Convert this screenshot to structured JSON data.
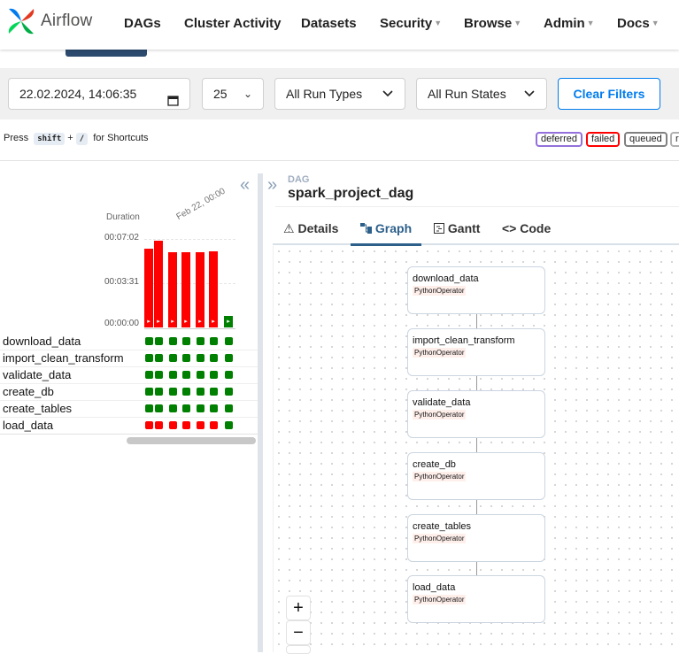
{
  "navbar": {
    "brand": "Airflow",
    "items": [
      {
        "label": "DAGs",
        "dropdown": false
      },
      {
        "label": "Cluster Activity",
        "dropdown": false
      },
      {
        "label": "Datasets",
        "dropdown": false
      },
      {
        "label": "Security",
        "dropdown": true
      },
      {
        "label": "Browse",
        "dropdown": true
      },
      {
        "label": "Admin",
        "dropdown": true
      },
      {
        "label": "Docs",
        "dropdown": true
      }
    ]
  },
  "filters": {
    "date_value": "22.02.2024, 14:06:35",
    "num_runs": "25",
    "run_types": "All Run Types",
    "run_states": "All Run States",
    "clear_label": "Clear Filters"
  },
  "shortcuts": {
    "press": "Press",
    "key1": "shift",
    "plus": "+",
    "key2": "/",
    "suffix": "for Shortcuts"
  },
  "state_legend": [
    {
      "label": "deferred",
      "color": "#9370db"
    },
    {
      "label": "failed",
      "color": "#ff0000"
    },
    {
      "label": "queued",
      "color": "#808080"
    },
    {
      "label": "r",
      "color": "#b0b0b0"
    }
  ],
  "grid": {
    "duration_label": "Duration",
    "date_label": "Feb 22, 00:00",
    "y_ticks": [
      "00:07:02",
      "00:03:31",
      "00:00:00"
    ],
    "runs": [
      {
        "duration_fraction": 0.91,
        "state": "failed"
      },
      {
        "duration_fraction": 1.0,
        "state": "failed"
      },
      {
        "duration_fraction": 0.87,
        "state": "failed"
      },
      {
        "duration_fraction": 0.87,
        "state": "failed"
      },
      {
        "duration_fraction": 0.87,
        "state": "failed"
      },
      {
        "duration_fraction": 0.88,
        "state": "failed"
      },
      {
        "duration_fraction": 0.0,
        "state": "success"
      }
    ],
    "tasks": [
      {
        "name": "download_data",
        "states": [
          "success",
          "success",
          "success",
          "success",
          "success",
          "success",
          "success"
        ]
      },
      {
        "name": "import_clean_transform",
        "states": [
          "success",
          "success",
          "success",
          "success",
          "success",
          "success",
          "success"
        ]
      },
      {
        "name": "validate_data",
        "states": [
          "success",
          "success",
          "success",
          "success",
          "success",
          "success",
          "success"
        ]
      },
      {
        "name": "create_db",
        "states": [
          "success",
          "success",
          "success",
          "success",
          "success",
          "success",
          "success"
        ]
      },
      {
        "name": "create_tables",
        "states": [
          "success",
          "success",
          "success",
          "success",
          "success",
          "success",
          "success"
        ]
      },
      {
        "name": "load_data",
        "states": [
          "failed",
          "failed",
          "failed",
          "failed",
          "failed",
          "failed",
          "success"
        ]
      }
    ],
    "colors": {
      "success": "#008000",
      "failed": "#ff0000"
    }
  },
  "dag": {
    "sub": "DAG",
    "name": "spark_project_dag"
  },
  "tabs": [
    {
      "label": "Details",
      "icon": "warning-icon"
    },
    {
      "label": "Graph",
      "icon": "graph-icon"
    },
    {
      "label": "Gantt",
      "icon": "gantt-icon"
    },
    {
      "label": "Code",
      "icon": "code-icon"
    }
  ],
  "graph_nodes": [
    {
      "name": "download_data",
      "operator": "PythonOperator"
    },
    {
      "name": "import_clean_transform",
      "operator": "PythonOperator"
    },
    {
      "name": "validate_data",
      "operator": "PythonOperator"
    },
    {
      "name": "create_db",
      "operator": "PythonOperator"
    },
    {
      "name": "create_tables",
      "operator": "PythonOperator"
    },
    {
      "name": "load_data",
      "operator": "PythonOperator"
    }
  ],
  "zoom": {
    "in": "+",
    "out": "−"
  }
}
